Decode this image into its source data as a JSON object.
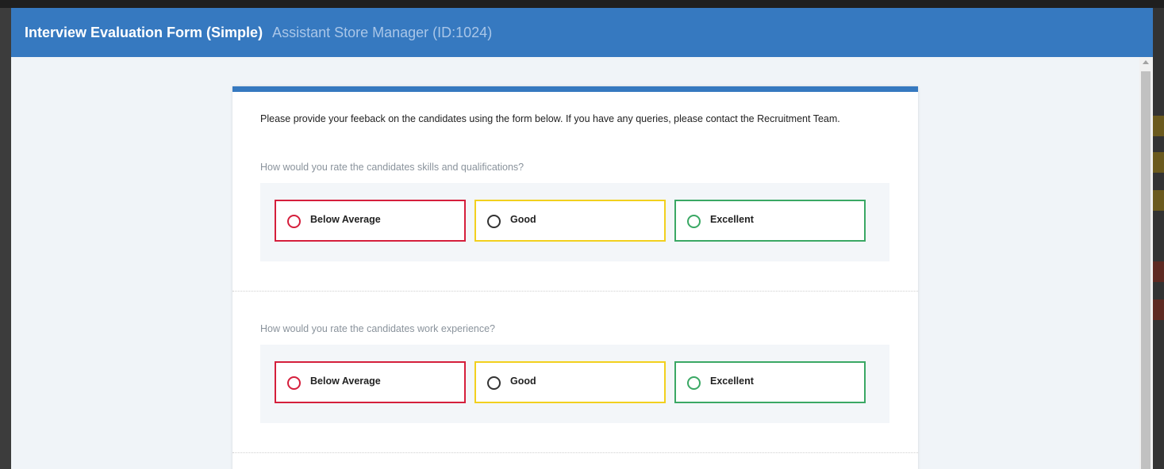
{
  "header": {
    "title": "Interview Evaluation Form (Simple)",
    "subtitle": "Assistant Store Manager (ID:1024)"
  },
  "form": {
    "intro": "Please provide your feeback on the candidates using the form below. If you have any queries, please contact the Recruitment Team.",
    "questions": [
      {
        "label": "How would you rate the candidates skills and qualifications?",
        "options": [
          {
            "label": "Below Average",
            "color": "#d51f3c"
          },
          {
            "label": "Good",
            "color": "#f2d01e"
          },
          {
            "label": "Excellent",
            "color": "#3aa864"
          }
        ]
      },
      {
        "label": "How would you rate the candidates work experience?",
        "options": [
          {
            "label": "Below Average",
            "color": "#d51f3c"
          },
          {
            "label": "Good",
            "color": "#f2d01e"
          },
          {
            "label": "Excellent",
            "color": "#3aa864"
          }
        ]
      }
    ]
  },
  "colors": {
    "header_bg": "#3679c0",
    "accent": "#3679c0"
  }
}
